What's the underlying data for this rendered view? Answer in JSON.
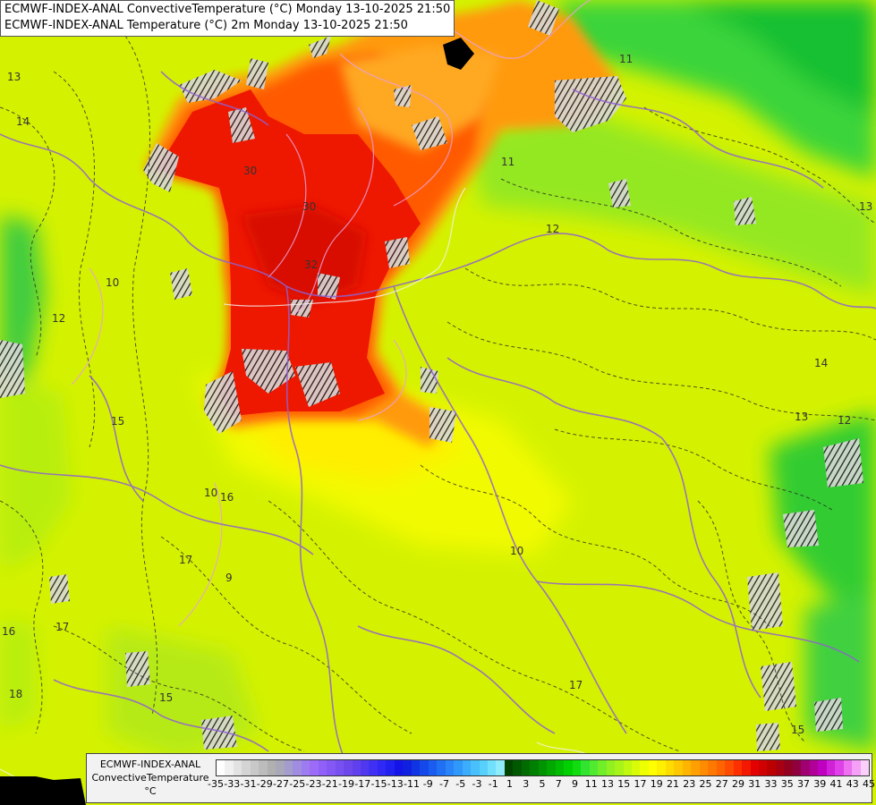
{
  "header": {
    "line1": "ECMWF-INDEX-ANAL ConvectiveTemperature (°C) Monday 13-10-2025 21:50",
    "line2": "ECMWF-INDEX-ANAL Temperature (°C) 2m Monday 13-10-2025 21:50"
  },
  "legend": {
    "title_line1": "ECMWF-INDEX-ANAL",
    "title_line2": "ConvectiveTemperature",
    "unit": "°C",
    "labels": [
      "-35",
      "-33",
      "-31",
      "-29",
      "-27",
      "-25",
      "-23",
      "-21",
      "-19",
      "-17",
      "-15",
      "-13",
      "-11",
      "-9",
      "-7",
      "-5",
      "-3",
      "-1",
      "1",
      "3",
      "5",
      "7",
      "9",
      "11",
      "13",
      "15",
      "17",
      "19",
      "21",
      "23",
      "25",
      "27",
      "29",
      "31",
      "33",
      "35",
      "37",
      "39",
      "41",
      "43",
      "45"
    ],
    "colors": [
      "#ffffff",
      "#f0f0f0",
      "#e2e2e2",
      "#d4d4d4",
      "#c8c8c8",
      "#bcbcbc",
      "#b0b0b0",
      "#a8a8b8",
      "#a49ccc",
      "#a08ce0",
      "#9c7cf0",
      "#9c6cf8",
      "#9060f8",
      "#8458f4",
      "#7850f0",
      "#6c48ec",
      "#6040ec",
      "#5038f0",
      "#4030f4",
      "#3028f4",
      "#2020f0",
      "#1414e8",
      "#1020e0",
      "#1034e4",
      "#1448ea",
      "#1a5cf0",
      "#2070f4",
      "#2884f8",
      "#3098fa",
      "#3cacfc",
      "#48c0fc",
      "#58d0fc",
      "#70e0fc",
      "#90ecfc",
      "#004400",
      "#005800",
      "#006c00",
      "#008000",
      "#009400",
      "#00a800",
      "#00bc00",
      "#00d000",
      "#10dc10",
      "#30e430",
      "#50ea30",
      "#70ee28",
      "#90f020",
      "#a8f418",
      "#c0f810",
      "#d8fc08",
      "#eeff00",
      "#ffff00",
      "#fff000",
      "#ffdc00",
      "#ffc800",
      "#ffb400",
      "#ffa000",
      "#ff8c00",
      "#ff7800",
      "#ff6400",
      "#ff4c00",
      "#ff3000",
      "#f41800",
      "#e40000",
      "#d00000",
      "#bc0000",
      "#a80010",
      "#940020",
      "#900040",
      "#a00070",
      "#b00098",
      "#c000c0",
      "#d020d8",
      "#e040e8",
      "#ec70f0",
      "#f4a0f6",
      "#fad0fa"
    ]
  },
  "contour_labels": [
    "13",
    "14",
    "11",
    "11",
    "13",
    "12",
    "30",
    "30",
    "32",
    "10",
    "12",
    "15",
    "16",
    "10",
    "17",
    "17",
    "16",
    "18",
    "15",
    "12",
    "14",
    "13",
    "15",
    "9",
    "10",
    "17"
  ],
  "icons": {
    "colorbar": "colorbar-legend"
  }
}
